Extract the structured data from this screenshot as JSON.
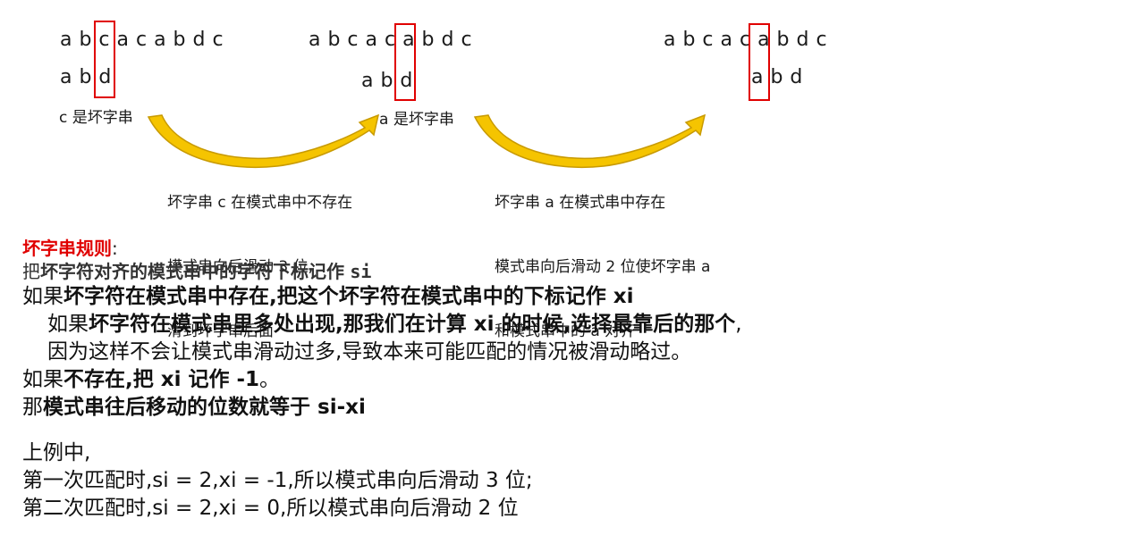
{
  "examples": [
    {
      "text_seq": "a b c a c a b d c",
      "pattern_seq": "a b d",
      "bad_char_label": "c 是坏字串"
    },
    {
      "text_seq": "a b c a c a b d c",
      "pattern_seq": "a b d",
      "bad_char_label": "a 是坏字串"
    },
    {
      "text_seq": "a b c a c a b d c",
      "pattern_seq": "a b d"
    }
  ],
  "notes": [
    {
      "lines": [
        "坏字串 c 在模式串中不存在",
        "模式串向后滑动 3 位,",
        "滑到坏字串后面"
      ]
    },
    {
      "lines": [
        "坏字串 a 在模式串中存在",
        "模式串向后滑动 2 位使坏字串 a",
        "和模式串中的 a 对齐"
      ]
    }
  ],
  "colors": {
    "highlight": "#e00000",
    "arrow_fill": "#f5c400",
    "arrow_shade": "#c89a00"
  },
  "rules": {
    "title": "坏字串规则",
    "title_colon": ":",
    "line1_prefix": "把",
    "line1_bold": "坏字符对齐的模式串中的字符下标记作",
    "line1_code": "si",
    "line2_prefix": "如果",
    "line2_bold": "坏字符在模式串中存在,把这个坏字符在模式串中的下标记作 xi",
    "line3_prefix": "如果",
    "line3_bold": "坏字符在模式串里多处出现,那我们在计算 xi 的时候,选择最靠后的那个",
    "line3_suffix": ",",
    "line4": "因为这样不会让模式串滑动过多,导致本来可能匹配的情况被滑动略过。",
    "line5_prefix": "如果",
    "line5_bold": "不存在,把 xi 记作 -1",
    "line5_suffix": "。",
    "line6_prefix": "那",
    "line6_bold": "模式串往后移动的位数就等于 si-xi"
  },
  "example_summary": {
    "intro": "上例中,",
    "first": "第一次匹配时,si = 2,xi = -1,所以模式串向后滑动 3 位;",
    "second": "第二次匹配时,si = 2,xi = 0,所以模式串向后滑动 2 位"
  }
}
